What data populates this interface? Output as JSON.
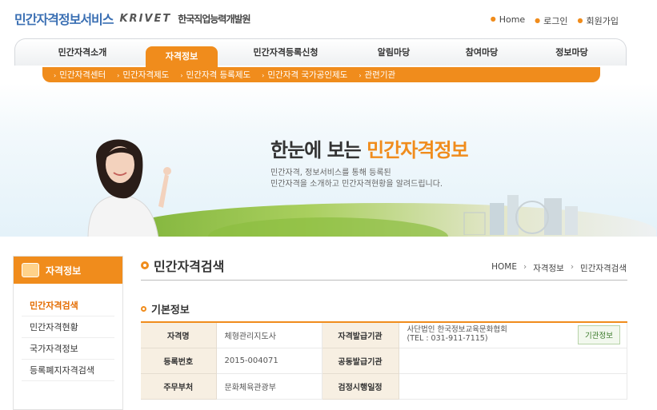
{
  "header": {
    "logo_title": "민간자격정보서비스",
    "logo_mark": "KRIVET",
    "logo_sub": "한국직업능력개발원",
    "util_links": [
      "Home",
      "로그인",
      "회원가입"
    ]
  },
  "nav": {
    "items": [
      "민간자격소개",
      "자격정보",
      "민간자격등록신청",
      "알림마당",
      "참여마당",
      "정보마당"
    ],
    "active": "자격정보",
    "sub_items": [
      "민간자격센터",
      "민간자격제도",
      "민간자격 등록제도",
      "민간자격 국가공인제도",
      "관련기관"
    ]
  },
  "hero": {
    "title_pre": "한눈에 보는 ",
    "title_highlight": "민간자격정보",
    "desc_line1": "민간자격, 정보서비스를 통해 등록된",
    "desc_line2": "민간자격을 소개하고 민간자격현황을 알려드립니다."
  },
  "sidebar": {
    "title": "자격정보",
    "items": [
      "민간자격검색",
      "민간자격현황",
      "국가자격정보",
      "등록폐지자격검색"
    ],
    "active": "민간자격검색"
  },
  "content": {
    "title": "민간자격검색",
    "breadcrumb": [
      "HOME",
      "자격정보",
      "민간자격검색"
    ],
    "section_title": "기본정보",
    "table": {
      "rows": [
        {
          "label1": "자격명",
          "value1": "체형관리지도사",
          "label2": "자격발급기관",
          "value2_line1": "사단법인 한국정보교육문화협회",
          "value2_line2": "(TEL : 031-911-7115)",
          "button": "기관정보"
        },
        {
          "label1": "등록번호",
          "value1": "2015-004071",
          "label2": "공동발급기관",
          "value2": ""
        },
        {
          "label1": "주무부처",
          "value1": "문화체육관광부",
          "label2": "검정시행일정",
          "value2": ""
        }
      ]
    }
  },
  "colors": {
    "accent": "#f08c1c",
    "brand_blue": "#3a6fb3"
  }
}
